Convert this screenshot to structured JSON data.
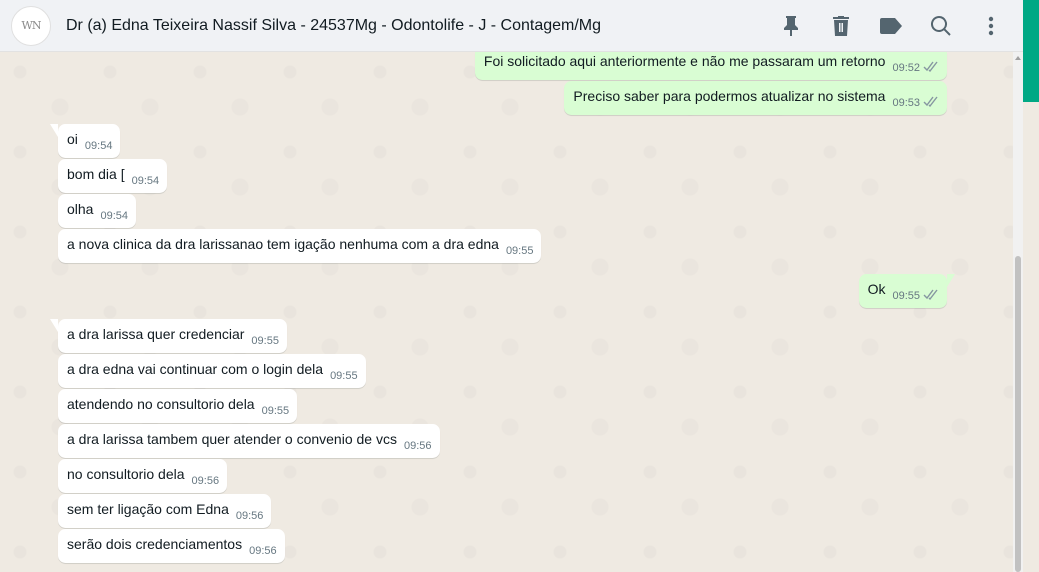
{
  "header": {
    "avatar_text": "WN",
    "title": "Dr (a) Edna Teixeira Nassif Silva - 24537Mg - Odontolife - J - Contagem/Mg",
    "icons": [
      "pin-icon",
      "delete-icon",
      "label-icon",
      "search-icon",
      "menu-icon"
    ]
  },
  "colors": {
    "header_bg": "#f0f2f5",
    "chat_bg": "#efeae2",
    "outgoing_bubble": "#d9fdd3",
    "incoming_bubble": "#ffffff",
    "accent": "#00a884",
    "read_ticks": "#8696a0"
  },
  "messages": [
    {
      "dir": "out",
      "text": "Foi solicitado aqui anteriormente e não me passaram um retorno",
      "time": "09:52"
    },
    {
      "dir": "out",
      "text": "Preciso saber para podermos atualizar no sistema",
      "time": "09:53"
    },
    {
      "dir": "in",
      "text": "oi",
      "time": "09:54"
    },
    {
      "dir": "in",
      "text": "bom dia [",
      "time": "09:54"
    },
    {
      "dir": "in",
      "text": "olha",
      "time": "09:54"
    },
    {
      "dir": "in",
      "text": "a nova clinica da dra larissanao tem igação nenhuma com a dra edna",
      "time": "09:55"
    },
    {
      "dir": "out",
      "text": "Ok",
      "time": "09:55"
    },
    {
      "dir": "in",
      "text": "a dra larissa quer credenciar",
      "time": "09:55"
    },
    {
      "dir": "in",
      "text": "a dra edna vai continuar com o login dela",
      "time": "09:55"
    },
    {
      "dir": "in",
      "text": "atendendo no consultorio dela",
      "time": "09:55"
    },
    {
      "dir": "in",
      "text": "a dra larissa tambem quer atender o convenio de vcs",
      "time": "09:56"
    },
    {
      "dir": "in",
      "text": "no consultorio dela",
      "time": "09:56"
    },
    {
      "dir": "in",
      "text": "sem ter ligação com Edna",
      "time": "09:56"
    },
    {
      "dir": "in",
      "text": "serão dois credenciamentos",
      "time": "09:56"
    }
  ]
}
